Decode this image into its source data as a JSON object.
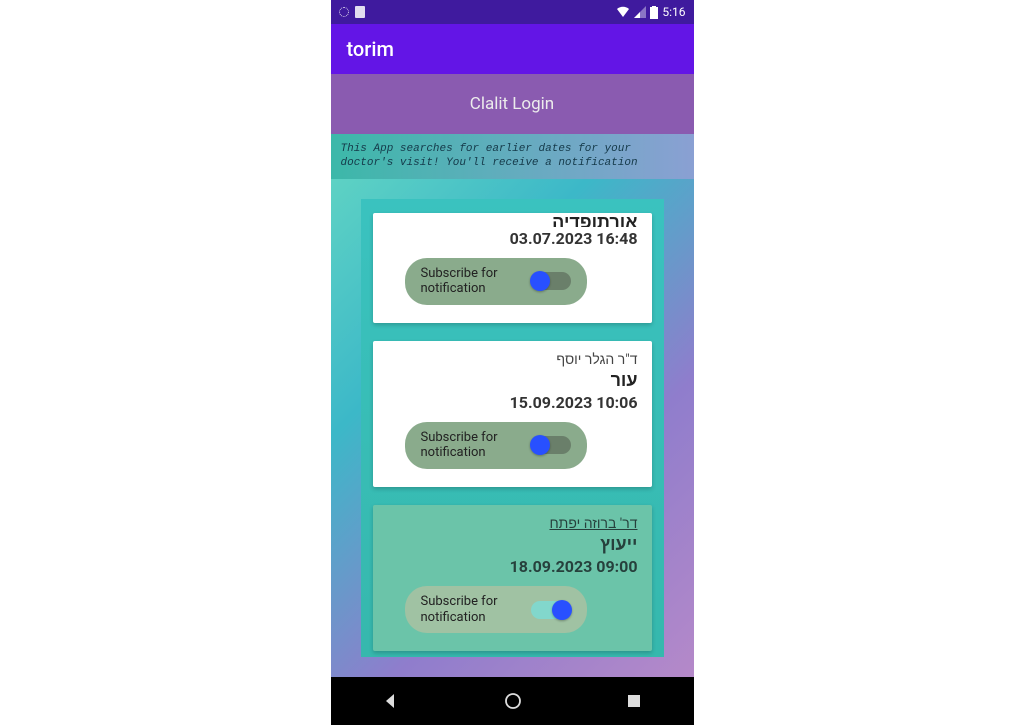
{
  "status": {
    "time": "5:16"
  },
  "appbar": {
    "title": "torim"
  },
  "login_bar": {
    "label": "Clalit Login"
  },
  "info": {
    "text": "This App searches for earlier dates for your doctor's visit! You'll receive a notification"
  },
  "subscribe_label": "Subscribe for notification",
  "cards": [
    {
      "doctor": "אורתופדיה",
      "specialty": "",
      "datetime": "03.07.2023 16:48",
      "subscribed": false,
      "highlight": false
    },
    {
      "doctor": "ד\"ר הגלר יוסף",
      "specialty": "עור",
      "datetime": "15.09.2023 10:06",
      "subscribed": false,
      "highlight": false
    },
    {
      "doctor": "דר' ברוזה יפתח",
      "specialty": "ייעוץ",
      "datetime": "18.09.2023 09:00",
      "subscribed": true,
      "highlight": true
    }
  ]
}
